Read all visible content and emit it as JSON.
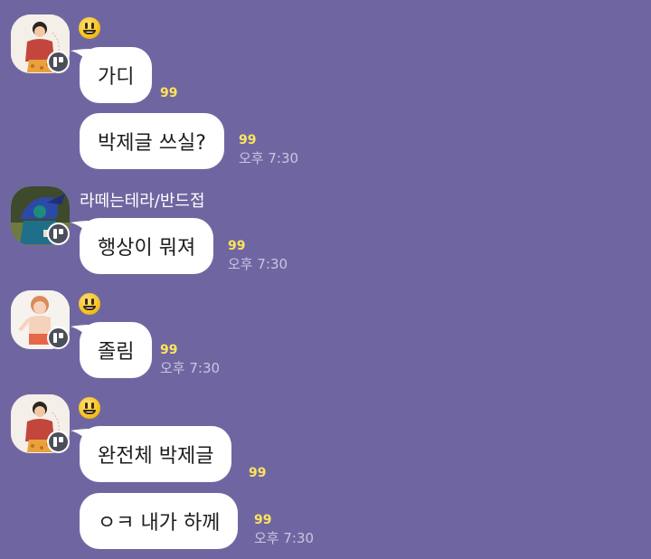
{
  "groups": [
    {
      "sender_emoji": "grinning-face",
      "messages": [
        {
          "text": "가디",
          "unread": "99",
          "time": ""
        },
        {
          "text": "박제글 쓰실?",
          "unread": "99",
          "time": "오후 7:30"
        }
      ]
    },
    {
      "sender_name": "라떼는테라/반드접",
      "messages": [
        {
          "text": "행상이 뭐져",
          "unread": "99",
          "time": "오후 7:30"
        }
      ]
    },
    {
      "sender_emoji": "grinning-face",
      "messages": [
        {
          "text": "졸림",
          "unread": "99",
          "time": "오후 7:30"
        }
      ]
    },
    {
      "sender_emoji": "grinning-face",
      "messages": [
        {
          "text": "완전체 박제글",
          "unread": "99",
          "time": ""
        },
        {
          "text": "ㅇㅋ 내가 하께",
          "unread": "99",
          "time": "오후 7:30"
        }
      ]
    }
  ],
  "colors": {
    "background": "#6f66a1",
    "bubble": "#ffffff",
    "unread": "#ffe45c",
    "time": "#cbc5e3"
  }
}
